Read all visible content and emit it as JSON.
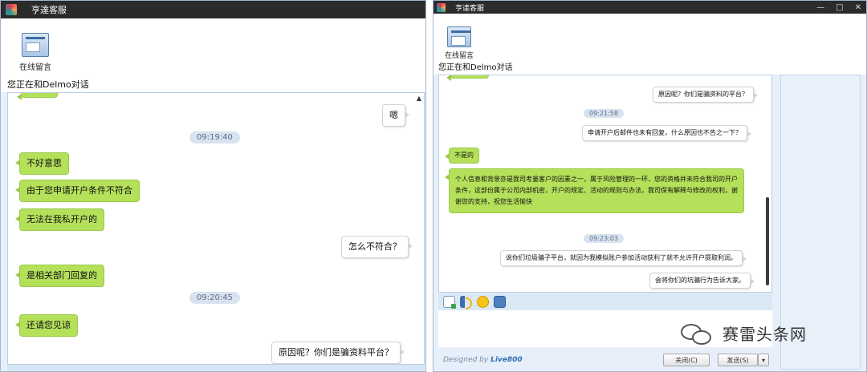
{
  "left_window": {
    "title": "亨達客服",
    "tool_label": "在线留言",
    "subtitle": "您正在和Delmo对话",
    "messages": {
      "m1": "嗯",
      "t1": "09:19:40",
      "m2": "不好意思",
      "m3": "由于您申请开户条件不符合",
      "m4": "无法在我私开户的",
      "m5": "怎么不符合？",
      "m6": "是相关部门回复的",
      "t2": "09:20:45",
      "m7": "还请您见谅",
      "m8": "原因呢？你们是骗资料平台？"
    }
  },
  "right_window": {
    "title": "亨達客服",
    "controls": {
      "minimize": "—",
      "maximize": "□",
      "close": "✕"
    },
    "tool_label": "在线留言",
    "subtitle": "您正在和Delmo对话",
    "messages": {
      "r1": "原因呢？你们是骗资料的平台？",
      "t1": "09:21:58",
      "r2": "申请开户后邮件也未有回复，什么原因也不告之一下？",
      "r3": "不是的",
      "r4": "个人信息和背景亦是我司考量客户的因素之一，属于风险管理的一环，您的资格并未符合我司的开户条件，这部份属于公司内部机密，开户的规定、活动的规则与办法，我司保有解释与修改的权利，谢谢您的支持，祝您生活愉快",
      "t2": "09:23:03",
      "r5": "说你们垃圾骗子平台，就因为我模拟账户参加活动获利了就不允许开户提取利润。",
      "r6": "会将你们的坑骗行为告诉大家。"
    },
    "toolbar_icons": [
      "file-icon",
      "sound-icon",
      "emoji-icon",
      "screenshot-icon"
    ],
    "footer": {
      "designed_prefix": "Designed by",
      "designed_brand": "Live800",
      "close_button": "关闭(C)",
      "send_button": "发送(S)",
      "send_dropdown": "▾"
    }
  },
  "watermark": {
    "label": "赛雷头条网"
  },
  "colors": {
    "agent_bubble": "#b4e05a",
    "user_bubble": "#ffffff",
    "titlebar": "#2b2b2b",
    "window_bg": "#e7f0fa"
  }
}
